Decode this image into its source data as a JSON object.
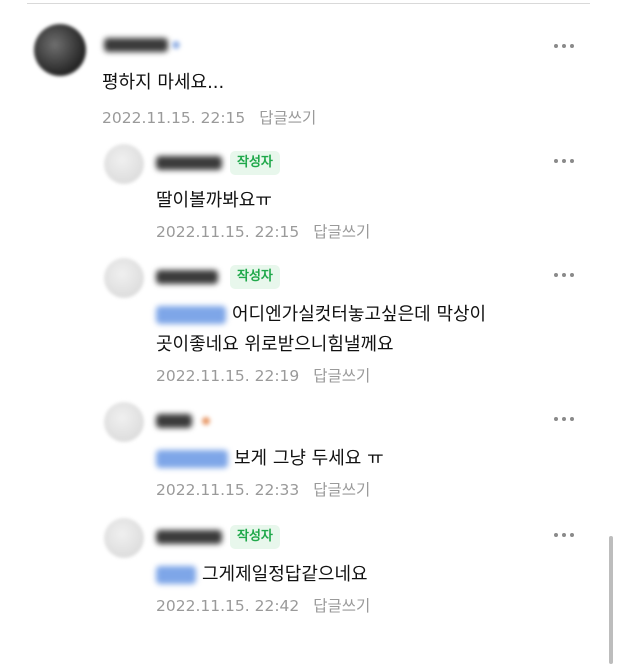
{
  "comments": [
    {
      "text": "평하지 마세요...",
      "date": "2022.11.15. 22:15",
      "reply_label": "답글쓰기",
      "is_writer": false
    },
    {
      "badge": "작성자",
      "text": "딸이볼까봐요ㅠ",
      "date": "2022.11.15. 22:15",
      "reply_label": "답글쓰기",
      "is_writer": true
    },
    {
      "badge": "작성자",
      "text_line1": "어디엔가실컷터놓고싶은데 막상이",
      "text_line2": "곳이좋네요 위로받으니힘낼께요",
      "date": "2022.11.15. 22:19",
      "reply_label": "답글쓰기",
      "is_writer": true
    },
    {
      "text": "보게 그냥 두세요 ㅠ",
      "date": "2022.11.15. 22:33",
      "reply_label": "답글쓰기",
      "is_writer": false
    },
    {
      "badge": "작성자",
      "text": "그게제일정답같으네요",
      "date": "2022.11.15. 22:42",
      "reply_label": "답글쓰기",
      "is_writer": true
    }
  ],
  "colors": {
    "badge_text": "#1fa84a",
    "badge_bg": "#e8f7ec",
    "meta_text": "#9a9a9a",
    "mention_blur": "#7ea6e8"
  },
  "icons": {
    "more": "more-horizontal-icon"
  }
}
